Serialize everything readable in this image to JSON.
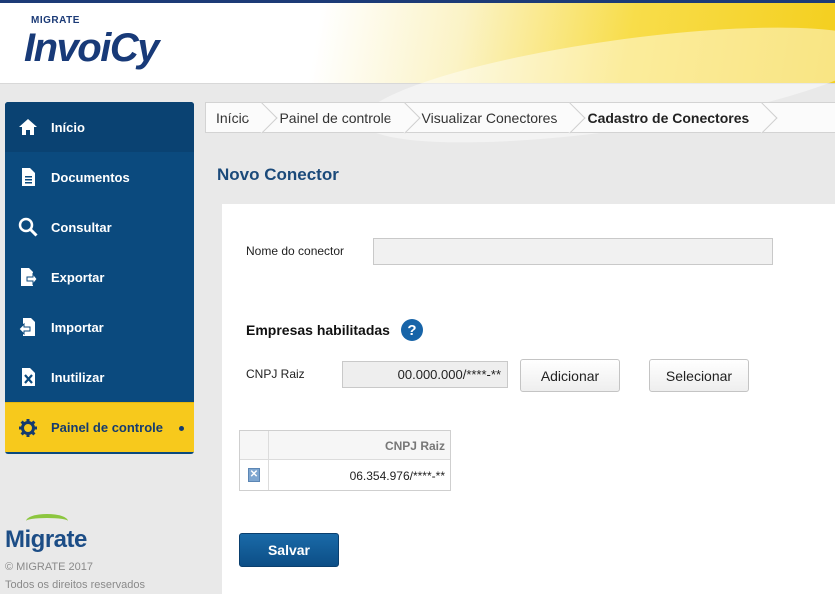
{
  "brand": {
    "small": "MIGRATE",
    "product": "InvoiCy",
    "company": "Migrate",
    "copyright": "© MIGRATE 2017",
    "rights": "Todos os direitos reservados"
  },
  "sidebar": {
    "items": [
      {
        "label": "Início",
        "icon": "home-icon"
      },
      {
        "label": "Documentos",
        "icon": "document-icon"
      },
      {
        "label": "Consultar",
        "icon": "search-icon"
      },
      {
        "label": "Exportar",
        "icon": "export-icon"
      },
      {
        "label": "Importar",
        "icon": "import-icon"
      },
      {
        "label": "Inutilizar",
        "icon": "void-icon"
      },
      {
        "label": "Painel de controle",
        "icon": "gear-icon",
        "active": true
      }
    ]
  },
  "breadcrumb": [
    "Início",
    "Painel de controle",
    "Visualizar Conectores",
    "Cadastro de Conectores"
  ],
  "page": {
    "title": "Novo Conector"
  },
  "form": {
    "name_label": "Nome do conector",
    "name_value": "",
    "section_title": "Empresas habilitadas",
    "help": "?",
    "cnpj_label": "CNPJ Raiz",
    "cnpj_value": "00.000.000/****-**",
    "add_button": "Adicionar",
    "select_button": "Selecionar",
    "save_button": "Salvar"
  },
  "table": {
    "header": "CNPJ Raiz",
    "rows": [
      {
        "cnpj": "06.354.976/****-**"
      }
    ]
  },
  "colors": {
    "nav_blue": "#0b4a7e",
    "active_yellow": "#f7c91c",
    "title_blue": "#1b4a7a"
  }
}
